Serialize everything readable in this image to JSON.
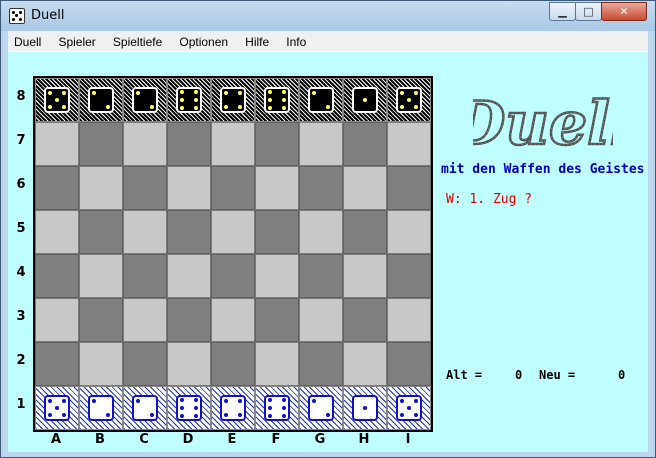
{
  "window": {
    "title": "Duell"
  },
  "menu": [
    "Duell",
    "Spieler",
    "Spieltiefe",
    "Optionen",
    "Hilfe",
    "Info"
  ],
  "board": {
    "ranks": [
      "8",
      "7",
      "6",
      "5",
      "4",
      "3",
      "2",
      "1"
    ],
    "files": [
      "A",
      "B",
      "C",
      "D",
      "E",
      "F",
      "G",
      "H",
      "I"
    ],
    "top_row_pips": [
      5,
      2,
      2,
      6,
      4,
      6,
      2,
      1,
      5
    ],
    "bottom_row_pips": [
      5,
      2,
      2,
      6,
      4,
      6,
      2,
      1,
      5
    ]
  },
  "logo_text": "Duell",
  "subtitle": "mit den Waffen des Geistes",
  "status": "W:  1. Zug  ?",
  "counters": {
    "alt_label": "Alt =",
    "alt_value": "0",
    "neu_label": "Neu =",
    "neu_value": "0"
  },
  "colors": {
    "client_bg": "#c0ffff",
    "subtitle": "#0000c0",
    "status": "#e00000"
  }
}
